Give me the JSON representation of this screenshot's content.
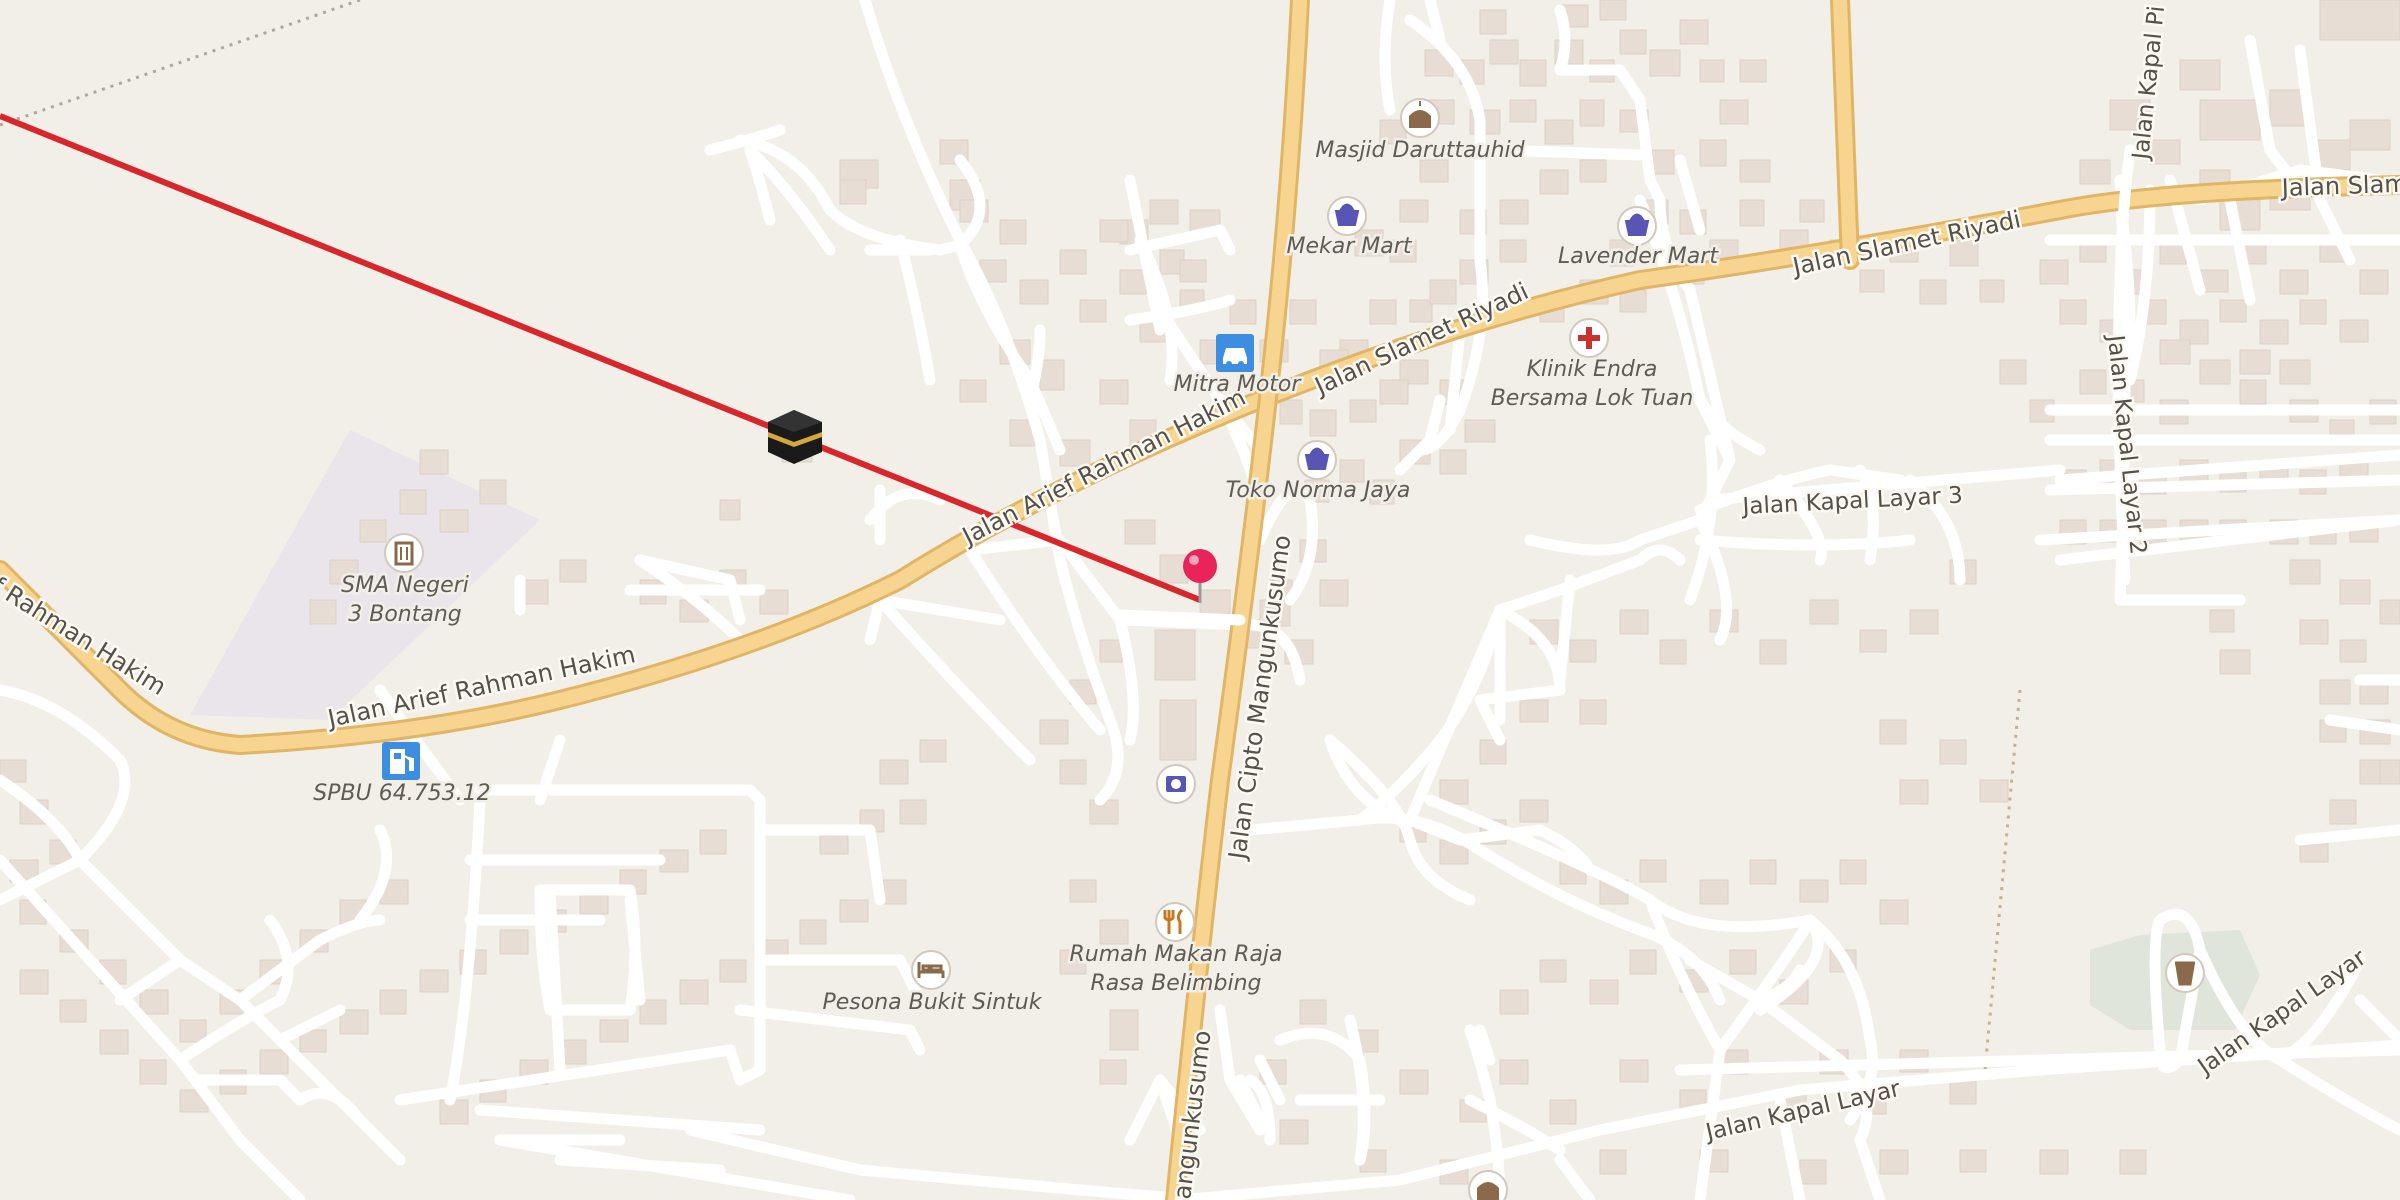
{
  "roads": {
    "main_west": "Jalan Arief Rahman Hakim",
    "main_west_edge": "f Rahman Hakim",
    "main_mid": "Jalan Arief Rahman Hakim",
    "slamet_1": "Jalan Slamet Riyadi",
    "slamet_2": "Jalan Slamet Riyadi",
    "slamet_3": "Jalan Slam",
    "cipto": "Jalan Cipto Mangunkusumo",
    "cipto_bottom": "angunkusumo",
    "kapal_layar_3": "Jalan Kapal Layar 3",
    "kapal_layar_2": "Jalan Kapal Layar 2",
    "kapal_layar": "Jalan Kapal Layar",
    "kapal_layar_se": "Jalan Kapal Layar",
    "kapal_pi": "Jalan Kapal Pi"
  },
  "pois": {
    "masjid": "Masjid Daruttauhid",
    "mekar_mart": "Mekar Mart",
    "lavender_mart": "Lavender Mart",
    "mitra_motor": "Mitra Motor",
    "klinik_1": "Klinik Endra",
    "klinik_2": "Bersama Lok Tuan",
    "toko_norma": "Toko Norma Jaya",
    "sma_1": "SMA Negeri",
    "sma_2": "3 Bontang",
    "spbu": "SPBU 64.753.12",
    "rumah_makan_1": "Rumah Makan Raja",
    "rumah_makan_2": "Rasa Belimbing",
    "pesona": "Pesona Bukit Sintuk"
  },
  "icons": {
    "mosque": "mosque-icon",
    "shop": "basket-icon",
    "car": "car-icon",
    "clinic": "medical-cross-icon",
    "school": "school-icon",
    "fuel": "fuel-icon",
    "restaurant": "fork-knife-icon",
    "hotel": "bed-icon",
    "photo": "camera-icon",
    "kaaba": "kaaba-icon",
    "pin": "location-pin-icon",
    "waste": "waste-bin-icon"
  },
  "colors": {
    "land": "#f1efe7",
    "building": "#e7ddd4",
    "minor_road": "#ffffff",
    "major_road": "#f7d590",
    "major_road_casing": "#e0b565",
    "qibla_line": "#d9262b",
    "pin": "#e8245a",
    "poi_purple": "#5855b5",
    "poi_brown": "#8a6a4a",
    "poi_blue": "#3d8ee0",
    "clinic_red": "#c8322f"
  }
}
